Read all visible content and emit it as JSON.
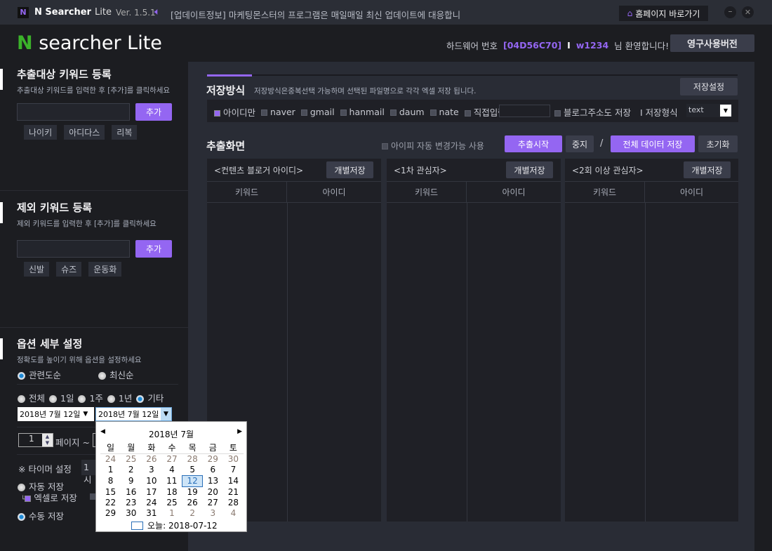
{
  "titlebar": {
    "app": "N Searcher",
    "app_lite": "Lite",
    "version": "Ver. 1.5.1",
    "notice": "[업데이트정보] 마케팅몬스터의 프로그램은 매일매일 최신 업데이트에 대응합니",
    "home": "홈페이지 바로가기"
  },
  "header": {
    "logo_n": "N",
    "logo_rest": " searcher Lite",
    "hw_label": "하드웨어 번호",
    "hw_id": "[04D56C70]",
    "sep": "I",
    "user": "w1234",
    "welcome": "님 환영합니다!",
    "license_button": "영구사용버전"
  },
  "colors": {
    "accent": "#9466f2",
    "logo_green": "#3bb22a"
  },
  "target_keywords": {
    "title": "추출대상 키워드 등록",
    "hint": "추출대상 키워드를 입력한 후 [추가]를 클릭하세요",
    "add": "추가",
    "tags": [
      "나이키",
      "아디다스",
      "리복"
    ]
  },
  "exclude_keywords": {
    "title": "제외 키워드 등록",
    "hint": "제외 키워드를 입력한 후 [추가]를 클릭하세요",
    "add": "추가",
    "tags": [
      "신발",
      "슈즈",
      "운동화"
    ]
  },
  "options": {
    "title": "옵션 세부 설정",
    "hint": "정확도를 높이기 위해 옵션을 설정하세요",
    "sort": [
      "관련도순",
      "최신순"
    ],
    "sort_selected": "관련도순",
    "period": [
      "전체",
      "1일",
      "1주",
      "1년",
      "기타"
    ],
    "period_selected": "기타",
    "date_from": "2018년   7월 12일",
    "date_to": "2018년   7월 12일",
    "page_from": "1",
    "page_label": "페이지 ~",
    "timer_label": "※ 타이머 설정",
    "timer_value": "1시",
    "auto_save": "자동 저장",
    "excel_save": "엑셀로 저장",
    "manual_save": "수동 저장",
    "save_selected": "수동 저장"
  },
  "calendar": {
    "title": "2018년 7월",
    "weekdays": [
      "일",
      "월",
      "화",
      "수",
      "목",
      "금",
      "토"
    ],
    "weeks": [
      [
        "24",
        "25",
        "26",
        "27",
        "28",
        "29",
        "30"
      ],
      [
        "1",
        "2",
        "3",
        "4",
        "5",
        "6",
        "7"
      ],
      [
        "8",
        "9",
        "10",
        "11",
        "12",
        "13",
        "14"
      ],
      [
        "15",
        "16",
        "17",
        "18",
        "19",
        "20",
        "21"
      ],
      [
        "22",
        "23",
        "24",
        "25",
        "26",
        "27",
        "28"
      ],
      [
        "29",
        "30",
        "31",
        "1",
        "2",
        "3",
        "4"
      ]
    ],
    "selected": "12",
    "today": "오늘: 2018-07-12"
  },
  "save_method": {
    "title": "저장방식",
    "hint": "저장방식은중복선택 가능하며 선택된 파일명으로 각각 엑셀 저장 됩니다.",
    "settings": "저장설정",
    "options": [
      "아이디만",
      "naver",
      "gmail",
      "hanmail",
      "daum",
      "nate",
      "직접입력"
    ],
    "checked": "아이디만",
    "blog_addr": "블로그주소도 저장",
    "format_label": "I 저장형식",
    "format_value": "text"
  },
  "extract": {
    "title": "추출화면",
    "ip_change": "아이피 자동 변경가능 사용",
    "start": "추출시작",
    "stop": "중지",
    "slash": "/",
    "save_all": "전체 데이터 저장",
    "reset": "초기화",
    "panels": [
      {
        "title": "<컨텐츠 블로거 아이디>",
        "save": "개별저장",
        "cols": [
          "키워드",
          "아이디"
        ]
      },
      {
        "title": "<1차 관심자>",
        "save": "개별저장",
        "cols": [
          "키워드",
          "아이디"
        ]
      },
      {
        "title": "<2회 이상 관심자>",
        "save": "개별저장",
        "cols": [
          "키워드",
          "아이디"
        ]
      }
    ]
  }
}
